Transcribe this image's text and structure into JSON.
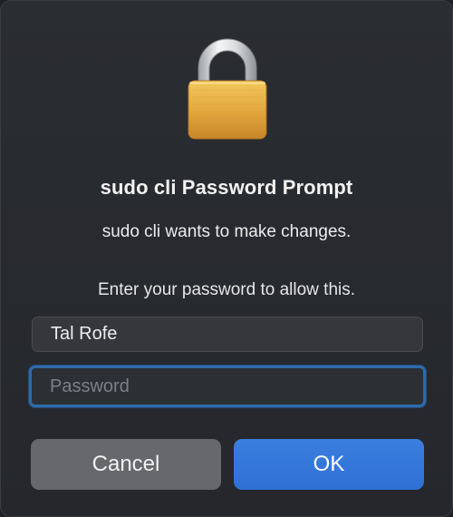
{
  "dialog": {
    "icon": "padlock-icon",
    "title": "sudo cli Password Prompt",
    "subtitle": "sudo cli wants to make changes.",
    "instruction": "Enter your password to allow this."
  },
  "fields": {
    "username_value": "Tal Rofe",
    "password_placeholder": "Password",
    "password_value": ""
  },
  "buttons": {
    "cancel_label": "Cancel",
    "ok_label": "OK"
  },
  "colors": {
    "background": "#25272c",
    "accent": "#2f70d4",
    "focus_ring": "#2f6aa8",
    "cancel_button": "#66686c",
    "lock_gold": "#e0a53a"
  }
}
